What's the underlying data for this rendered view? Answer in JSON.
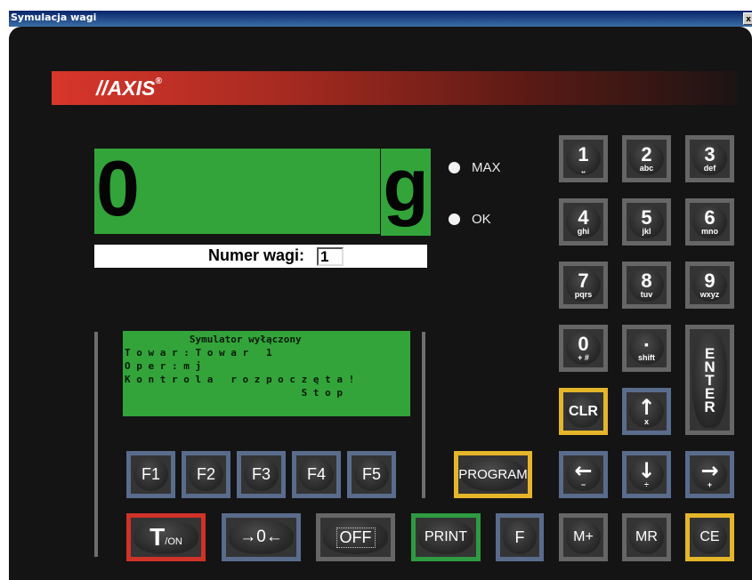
{
  "window": {
    "title": "Symulacja wagi",
    "close_label": "x"
  },
  "brand": {
    "name": "//AXIS",
    "reg": "®"
  },
  "display": {
    "value": "0",
    "unit": "g",
    "color": "#33a43a"
  },
  "indicators": {
    "max_label": "MAX",
    "ok_label": "OK"
  },
  "scale_number": {
    "label": "Numer wagi:",
    "value": "1"
  },
  "lcd": {
    "lines": [
      "           Symulator wyłączony",
      "T o w a r : T o w a r   1",
      "O p e r : m j",
      "K o n t r o l a   r o z p o c z ę t a !",
      "                              S t o p"
    ]
  },
  "keypad": {
    "k1": {
      "num": "1",
      "sub": "⎵"
    },
    "k2": {
      "num": "2",
      "sub": "abc"
    },
    "k3": {
      "num": "3",
      "sub": "def"
    },
    "k4": {
      "num": "4",
      "sub": "ghi"
    },
    "k5": {
      "num": "5",
      "sub": "jkl"
    },
    "k6": {
      "num": "6",
      "sub": "mno"
    },
    "k7": {
      "num": "7",
      "sub": "pqrs"
    },
    "k8": {
      "num": "8",
      "sub": "tuv"
    },
    "k9": {
      "num": "9",
      "sub": "wxyz"
    },
    "k0": {
      "num": "0",
      "sub": "+ #"
    },
    "dot": {
      "num": "▪",
      "sub": "shift"
    },
    "enter": [
      "E",
      "N",
      "T",
      "E",
      "R"
    ],
    "clr": "CLR",
    "up": {
      "arrow": "↑",
      "sub": "x"
    },
    "left": {
      "arrow": "←",
      "sub": "−"
    },
    "down": {
      "arrow": "↓",
      "sub": "÷"
    },
    "right": {
      "arrow": "→",
      "sub": "+"
    }
  },
  "function_keys": [
    "F1",
    "F2",
    "F3",
    "F4",
    "F5"
  ],
  "program_label": "PROGRAM",
  "bottom_row": {
    "tare": {
      "main": "T",
      "sub": "/ON"
    },
    "zero": "→0←",
    "off": "OFF",
    "print": "PRINT",
    "f": "F",
    "mplus": "M+",
    "mr": "MR",
    "ce": "CE"
  }
}
